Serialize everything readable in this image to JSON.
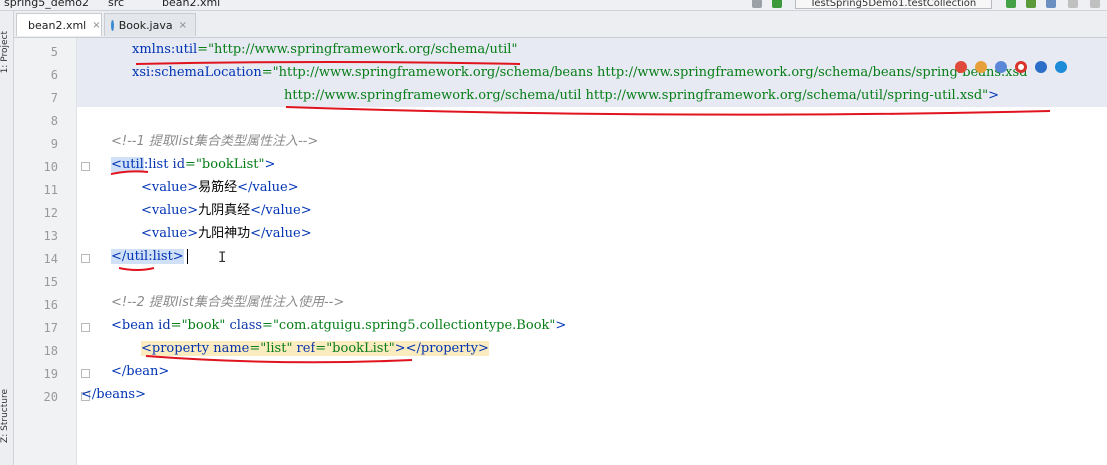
{
  "breadcrumb": {
    "project": "spring5_demo2",
    "folder": "src",
    "file": "bean2.xml"
  },
  "run_config": "TestSpring5Demo1.testCollection",
  "side_panels": {
    "project": "1: Project",
    "structure": "Z: Structure"
  },
  "tabs": [
    {
      "label": "bean2.xml",
      "active": true,
      "icon": "xml-file-icon",
      "close": "×"
    },
    {
      "label": "Book.java",
      "active": false,
      "icon": "java-class-icon",
      "close": "×"
    }
  ],
  "line_numbers": [
    "5",
    "6",
    "7",
    "8",
    "9",
    "10",
    "11",
    "12",
    "13",
    "14",
    "15",
    "16",
    "17",
    "18",
    "19",
    "20"
  ],
  "code": {
    "l5": {
      "tag": "xmlns:util",
      "eq": "=",
      "val": "\"http://www.springframework.org/schema/util\""
    },
    "l6": {
      "tag": "xsi:schemaLocation",
      "eq": "=",
      "val": "\"http://www.springframework.org/schema/beans http://www.springframework.org/schema/beans/spring-beans.xsd"
    },
    "l7": {
      "val": "http://www.springframework.org/schema/util http://www.springframework.org/schema/util/spring-util.xsd\"",
      "close": ">"
    },
    "l9": {
      "comment": "<!--1 提取list集合类型属性注入-->"
    },
    "l10": {
      "lt": "<",
      "ns": "util",
      "rest": ":list",
      "attr": " id",
      "eq": "=",
      "val": "\"bookList\"",
      "gt": ">"
    },
    "l11": {
      "open": "<value>",
      "text": "易筋经",
      "close": "</value>"
    },
    "l12": {
      "open": "<value>",
      "text": "九阴真经",
      "close": "</value>"
    },
    "l13": {
      "open": "<value>",
      "text": "九阳神功",
      "close": "</value>"
    },
    "l14": {
      "lt": "</",
      "ns": "util",
      "rest": ":list",
      "gt": ">"
    },
    "l16": {
      "comment": "<!--2 提取list集合类型属性注入使用-->"
    },
    "l17": {
      "open": "<bean",
      "a1": " id",
      "eq1": "=",
      "v1": "\"book\"",
      "a2": " class",
      "eq2": "=",
      "v2": "\"com.atguigu.spring5.collectiontype.Book\"",
      "gt": ">"
    },
    "l18": {
      "open": "<property",
      "a1": " name",
      "eq1": "=",
      "v1": "\"list\"",
      "a2": " ref",
      "eq2": "=",
      "v2": "\"bookList\"",
      "gt": ">",
      "close": "</property>"
    },
    "l19": {
      "close": "</bean>"
    },
    "l20": {
      "close": "</beans>"
    }
  },
  "colors": {
    "tag": "#0033b3",
    "string": "#067d17",
    "comment": "#8c8c8c",
    "annotation": "#e0141e"
  }
}
